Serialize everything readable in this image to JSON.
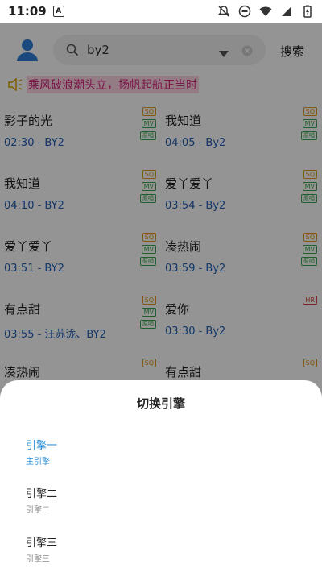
{
  "status_bar": {
    "time": "11:09",
    "app_icon_letter": "A"
  },
  "header": {
    "search_value": "by2",
    "search_button": "搜索"
  },
  "notice": "乘风破浪潮头立，扬帆起航正当时",
  "songs": [
    [
      {
        "title": "影子的光",
        "meta": "02:30 - BY2",
        "tags": [
          "SQ",
          "MV",
          "原唱"
        ]
      },
      {
        "title": "我知道",
        "meta": "04:05 - By2",
        "tags": [
          "SQ",
          "MV",
          "原唱"
        ]
      }
    ],
    [
      {
        "title": "我知道",
        "meta": "04:10 - BY2",
        "tags": [
          "SQ",
          "MV",
          "原唱"
        ]
      },
      {
        "title": "爱丫爱丫",
        "meta": "03:54 - By2",
        "tags": [
          "SQ",
          "MV",
          "原唱"
        ]
      }
    ],
    [
      {
        "title": "爱丫爱丫",
        "meta": "03:51 - BY2",
        "tags": [
          "SQ",
          "MV",
          "原唱"
        ]
      },
      {
        "title": "凑热闹",
        "meta": "03:59 - By2",
        "tags": [
          "SQ",
          "MV",
          "原唱"
        ]
      }
    ],
    [
      {
        "title": "有点甜",
        "meta": "03:55 - 汪苏泷、BY2",
        "tags": [
          "SQ",
          "MV",
          "原唱"
        ]
      },
      {
        "title": "爱你",
        "meta": "03:30 - By2",
        "tags": [
          "HR"
        ]
      }
    ],
    [
      {
        "title": "凑热闹",
        "meta": "",
        "tags": [
          "SQ"
        ]
      },
      {
        "title": "有点甜",
        "meta": "",
        "tags": [
          "SQ"
        ]
      }
    ]
  ],
  "sheet": {
    "title": "切换引擎",
    "engines": [
      {
        "name": "引擎一",
        "sub": "主引擎",
        "active": true
      },
      {
        "name": "引擎二",
        "sub": "引擎二",
        "active": false
      },
      {
        "name": "引擎三",
        "sub": "引擎三",
        "active": false
      }
    ]
  },
  "colors": {
    "accent": "#2a8fd6",
    "link": "#1f5fb4",
    "notice": "#d4237a",
    "sq": "#e0961b",
    "mv": "#3aa24b",
    "hr": "#d9433a"
  }
}
